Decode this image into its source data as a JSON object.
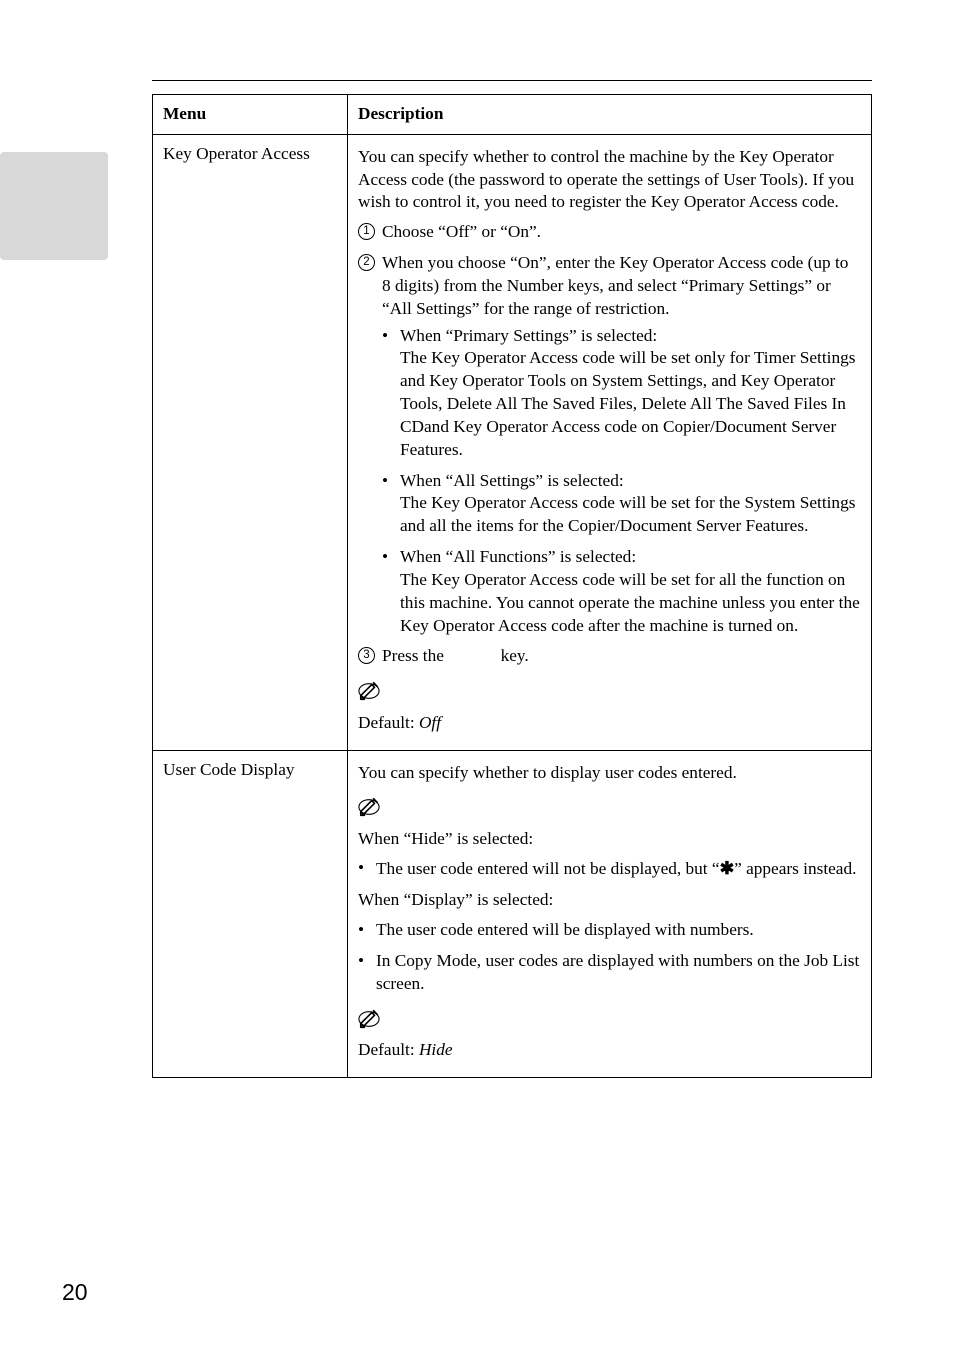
{
  "page_number": "20",
  "table": {
    "headers": {
      "menu": "Menu",
      "description": "Description"
    },
    "rows": [
      {
        "menu": "Key Operator Access",
        "intro": "You can specify whether to control the machine by the Key Operator Access code (the password to operate the settings of User Tools). If you wish to control it, you need to register the Key Operator Access code.",
        "steps": [
          {
            "n": "1",
            "text": "Choose “Off” or “On”."
          },
          {
            "n": "2",
            "text": "When you choose “On”, enter the Key Operator Access code (up to 8 digits) from the Number keys, and select “Primary Settings” or “All Settings” for the range of restriction."
          },
          {
            "n": "3",
            "text_pre": "Press the ",
            "text_post": " key."
          }
        ],
        "step2_bullets": [
          "When “Primary Settings” is selected:\nThe Key Operator Access code will be set only for Timer Settings and Key Operator Tools on System Settings, and Key Operator Tools, Delete All The Saved Files, Delete All The Saved Files In CDand Key Operator Access code on Copier/Document Server Features.",
          "When “All Settings” is selected:\nThe Key Operator Access code will be set for the System Settings and all the items for the Copier/Document Server Features.",
          "When “All Functions” is selected:\nThe Key Operator Access code will be set for all the function on this machine. You cannot operate the machine unless you enter the Key Operator Access code after the machine is turned on."
        ],
        "default_label": "Default: ",
        "default_value": "Off"
      },
      {
        "menu": "User Code Display",
        "intro": "You can specify whether to display user codes entered.",
        "hide_head": "When “Hide” is selected:",
        "hide_bullets_pre": "The user code entered will not be displayed, but “",
        "hide_bullets_post": "” appears instead.",
        "display_head": "When “Display” is selected:",
        "display_bullets": [
          "The user code entered will be displayed with numbers.",
          "In Copy Mode, user codes are displayed with numbers on the Job List screen."
        ],
        "default_label": "Default: ",
        "default_value": "Hide"
      }
    ]
  },
  "icons": {
    "star": "✱"
  }
}
